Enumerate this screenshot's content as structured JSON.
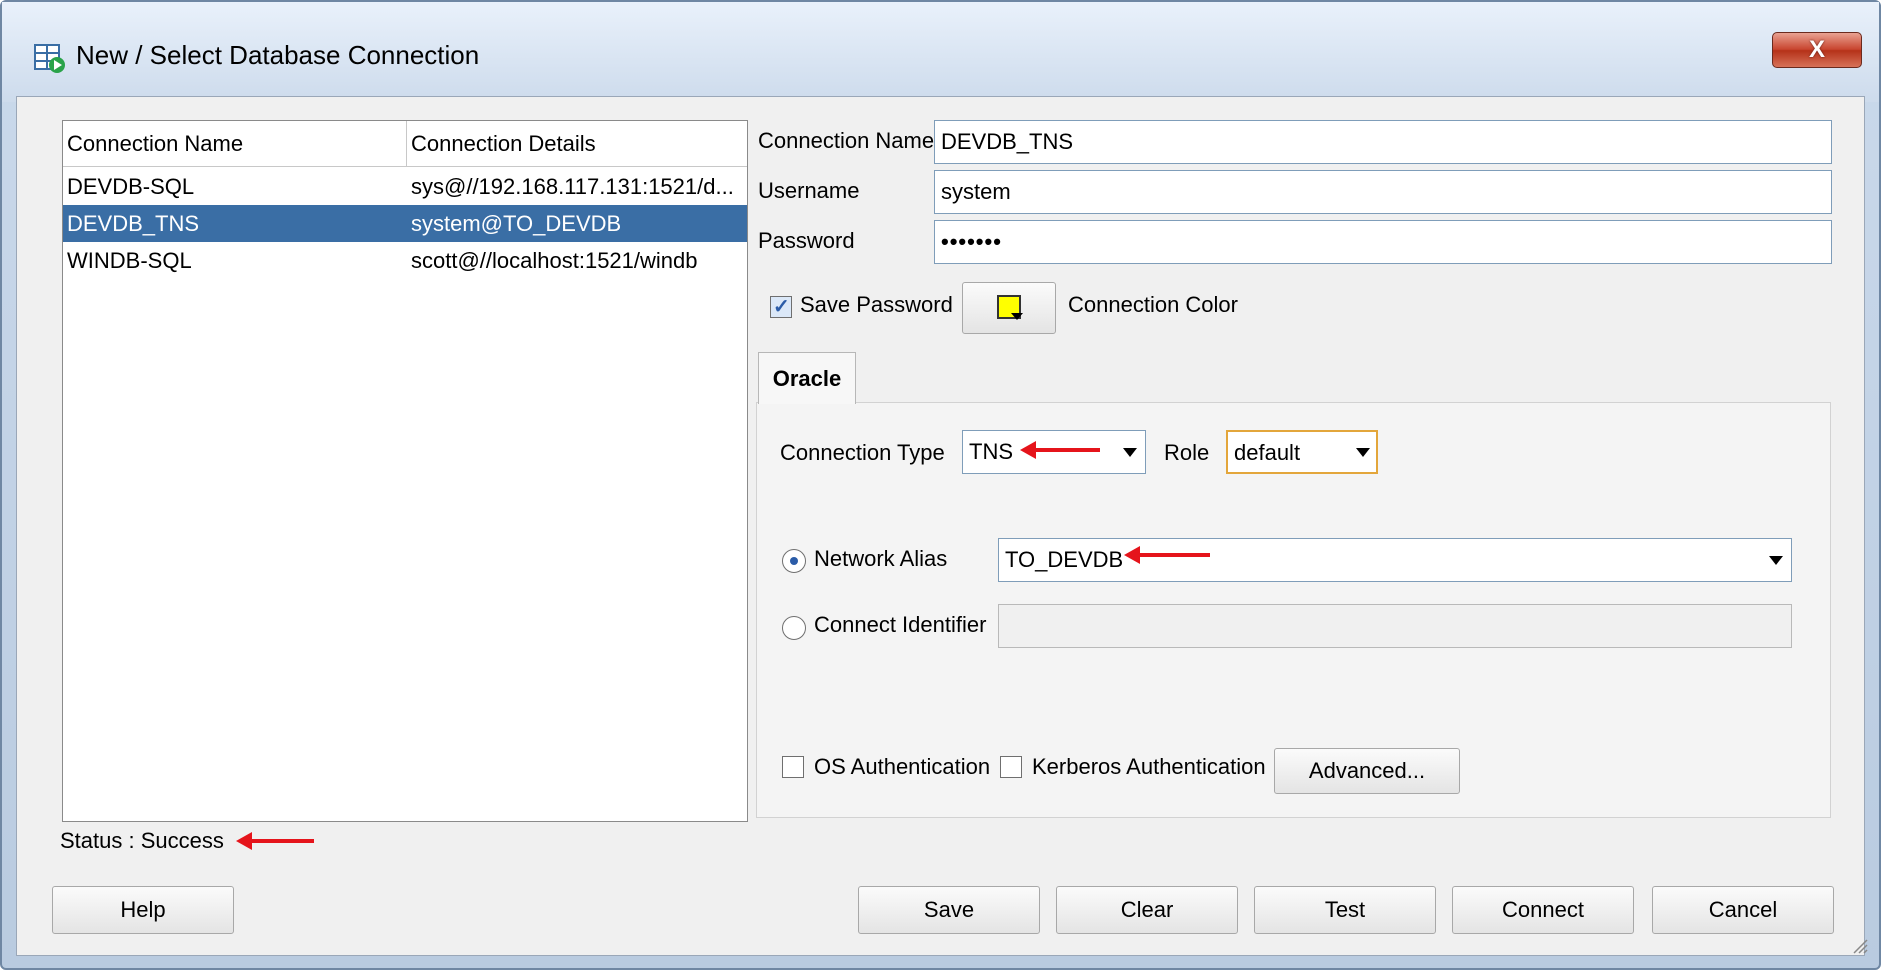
{
  "window": {
    "title": "New / Select Database Connection",
    "close_glyph": "X"
  },
  "table": {
    "headers": [
      "Connection Name",
      "Connection Details"
    ],
    "rows": [
      {
        "name": "DEVDB-SQL",
        "details": "sys@//192.168.117.131:1521/d..."
      },
      {
        "name": "DEVDB_TNS",
        "details": "system@TO_DEVDB",
        "selected": true
      },
      {
        "name": "WINDB-SQL",
        "details": "scott@//localhost:1521/windb"
      }
    ]
  },
  "status": "Status : Success",
  "form": {
    "connection_name_label": "Connection Name",
    "connection_name_value": "DEVDB_TNS",
    "username_label": "Username",
    "username_value": "system",
    "password_label": "Password",
    "password_value": "•••••••",
    "save_password_label": "Save Password",
    "save_password_checked": true,
    "connection_color_label": "Connection Color",
    "connection_color": "#ffff00"
  },
  "tab": {
    "label": "Oracle"
  },
  "oracle": {
    "connection_type_label": "Connection Type",
    "connection_type_value": "TNS",
    "role_label": "Role",
    "role_value": "default",
    "network_alias_label": "Network Alias",
    "network_alias_value": "TO_DEVDB",
    "network_alias_selected": true,
    "connect_identifier_label": "Connect Identifier",
    "connect_identifier_value": "",
    "os_auth_label": "OS Authentication",
    "kerberos_auth_label": "Kerberos Authentication",
    "advanced_label": "Advanced..."
  },
  "buttons": {
    "help": "Help",
    "save": "Save",
    "clear": "Clear",
    "test": "Test",
    "connect": "Connect",
    "cancel": "Cancel"
  },
  "colors": {
    "selection": "#3a6ea5",
    "annotation_arrow": "#e5141b"
  }
}
